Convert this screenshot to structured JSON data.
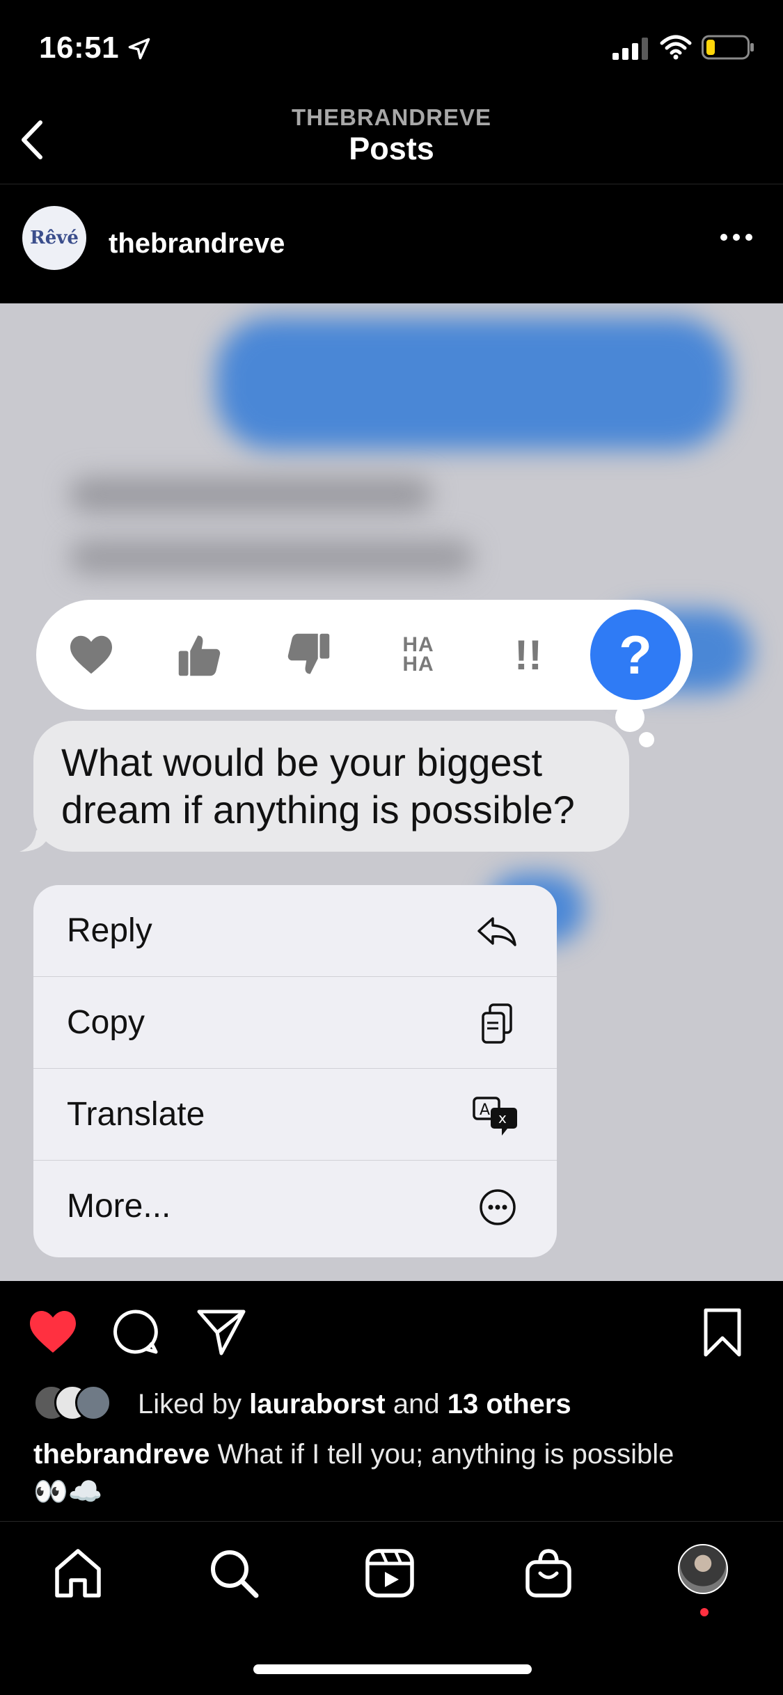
{
  "status_bar": {
    "time": "16:51",
    "icons": [
      "location-arrow-icon",
      "signal-icon",
      "wifi-icon",
      "battery-icon"
    ]
  },
  "header": {
    "subtitle": "THEBRANDREVE",
    "title": "Posts"
  },
  "post": {
    "author": "thebrandreve",
    "avatar_text": "Rêvé",
    "reactions": [
      "heart",
      "thumbs-up",
      "thumbs-down",
      "HA HA",
      "!!",
      "?"
    ],
    "haha_line1": "HA",
    "haha_line2": "HA",
    "excl": "!!",
    "question": "?",
    "message_line1": "What would be your biggest",
    "message_line2": "dream if anything is possible?",
    "menu": [
      {
        "label": "Reply",
        "icon": "reply-icon"
      },
      {
        "label": "Copy",
        "icon": "copy-icon"
      },
      {
        "label": "Translate",
        "icon": "translate-icon"
      },
      {
        "label": "More...",
        "icon": "more-icon"
      }
    ]
  },
  "likes": {
    "prefix": "Liked by",
    "user": "lauraborst",
    "joiner": "and",
    "others": "13 others"
  },
  "caption": {
    "author": "thebrandreve",
    "text": "What if I tell you; anything is possible",
    "emojis": "👀☁️"
  },
  "colors": {
    "accent_blue": "#2f7bf5",
    "like_red": "#ff3040",
    "background": "#000000"
  }
}
